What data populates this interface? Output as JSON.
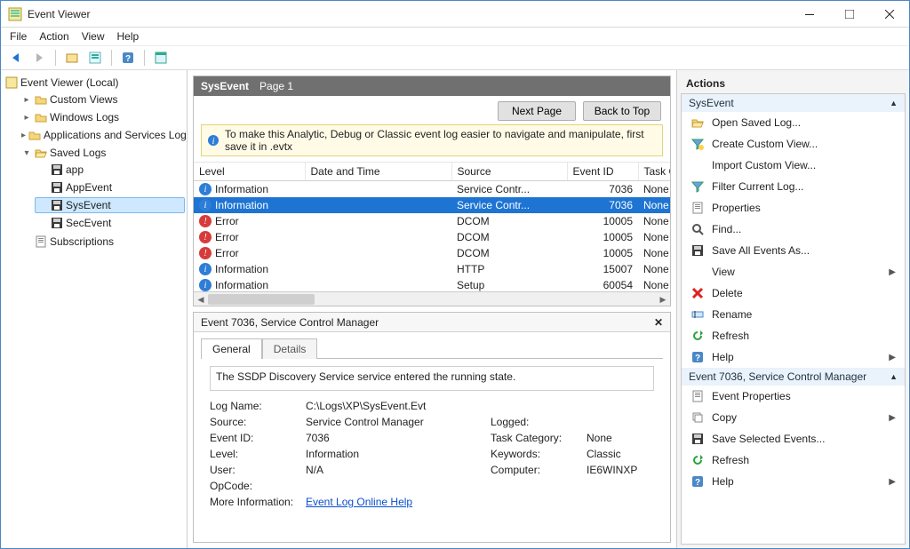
{
  "window": {
    "title": "Event Viewer"
  },
  "menubar": [
    "File",
    "Action",
    "View",
    "Help"
  ],
  "tree": {
    "root": "Event Viewer (Local)",
    "nodes": [
      {
        "label": "Custom Views",
        "icon": "folder"
      },
      {
        "label": "Windows Logs",
        "icon": "folder"
      },
      {
        "label": "Applications and Services Logs",
        "icon": "folder"
      },
      {
        "label": "Saved Logs",
        "icon": "folder-open",
        "children": [
          {
            "label": "app"
          },
          {
            "label": "AppEvent"
          },
          {
            "label": "SysEvent",
            "selected": true
          },
          {
            "label": "SecEvent"
          }
        ]
      },
      {
        "label": "Subscriptions",
        "icon": "page"
      }
    ]
  },
  "center": {
    "header_name": "SysEvent",
    "header_page": "Page 1",
    "buttons": {
      "next": "Next Page",
      "top": "Back to Top"
    },
    "infobar": "To make this Analytic, Debug or Classic event log easier to navigate and manipulate, first save it in .evtx",
    "columns": [
      "Level",
      "Date and Time",
      "Source",
      "Event ID",
      "Task Cate"
    ],
    "rows": [
      {
        "level": "Information",
        "lv": "info",
        "dt": "",
        "src": "Service Contr...",
        "id": "7036",
        "cat": "None"
      },
      {
        "level": "Information",
        "lv": "info",
        "dt": "",
        "src": "Service Contr...",
        "id": "7036",
        "cat": "None",
        "selected": true
      },
      {
        "level": "Error",
        "lv": "error",
        "dt": "",
        "src": "DCOM",
        "id": "10005",
        "cat": "None"
      },
      {
        "level": "Error",
        "lv": "error",
        "dt": "",
        "src": "DCOM",
        "id": "10005",
        "cat": "None"
      },
      {
        "level": "Error",
        "lv": "error",
        "dt": "",
        "src": "DCOM",
        "id": "10005",
        "cat": "None"
      },
      {
        "level": "Information",
        "lv": "info",
        "dt": "",
        "src": "HTTP",
        "id": "15007",
        "cat": "None"
      },
      {
        "level": "Information",
        "lv": "info",
        "dt": "",
        "src": "Setup",
        "id": "60054",
        "cat": "None"
      }
    ]
  },
  "detail": {
    "title": "Event 7036, Service Control Manager",
    "tabs": {
      "general": "General",
      "details": "Details"
    },
    "message": "The SSDP Discovery Service service entered the running state.",
    "props": {
      "logname_k": "Log Name:",
      "logname_v": "C:\\Logs\\XP\\SysEvent.Evt",
      "source_k": "Source:",
      "source_v": "Service Control Manager",
      "logged_k": "Logged:",
      "logged_v": "",
      "eventid_k": "Event ID:",
      "eventid_v": "7036",
      "taskcat_k": "Task Category:",
      "taskcat_v": "None",
      "level_k": "Level:",
      "level_v": "Information",
      "keywords_k": "Keywords:",
      "keywords_v": "Classic",
      "user_k": "User:",
      "user_v": "N/A",
      "computer_k": "Computer:",
      "computer_v": "IE6WINXP",
      "opcode_k": "OpCode:",
      "opcode_v": "",
      "moreinfo_k": "More Information:",
      "moreinfo_link": "Event Log Online Help"
    }
  },
  "actions": {
    "title": "Actions",
    "group1": {
      "header": "SysEvent",
      "items": [
        {
          "label": "Open Saved Log...",
          "icon": "folder-open"
        },
        {
          "label": "Create Custom View...",
          "icon": "funnel-new"
        },
        {
          "label": "Import Custom View...",
          "icon": "blank"
        },
        {
          "label": "Filter Current Log...",
          "icon": "funnel"
        },
        {
          "label": "Properties",
          "icon": "page"
        },
        {
          "label": "Find...",
          "icon": "find"
        },
        {
          "label": "Save All Events As...",
          "icon": "save"
        },
        {
          "label": "View",
          "icon": "blank",
          "submenu": true
        },
        {
          "label": "Delete",
          "icon": "delete"
        },
        {
          "label": "Rename",
          "icon": "rename"
        },
        {
          "label": "Refresh",
          "icon": "refresh"
        },
        {
          "label": "Help",
          "icon": "help",
          "submenu": true
        }
      ]
    },
    "group2": {
      "header": "Event 7036, Service Control Manager",
      "items": [
        {
          "label": "Event Properties",
          "icon": "page"
        },
        {
          "label": "Copy",
          "icon": "copy",
          "submenu": true
        },
        {
          "label": "Save Selected Events...",
          "icon": "save"
        },
        {
          "label": "Refresh",
          "icon": "refresh"
        },
        {
          "label": "Help",
          "icon": "help",
          "submenu": true
        }
      ]
    }
  }
}
